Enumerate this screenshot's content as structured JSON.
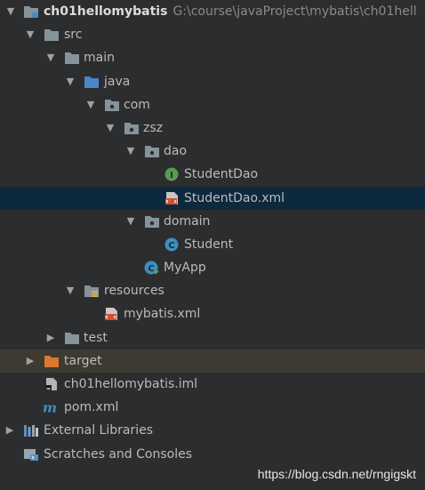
{
  "project": {
    "name": "ch01hellomybatis",
    "path": "G:\\course\\javaProject\\mybatis\\ch01hell"
  },
  "tree": {
    "src": "src",
    "main": "main",
    "java": "java",
    "com": "com",
    "zsz": "zsz",
    "dao": "dao",
    "student_dao": "StudentDao",
    "student_dao_xml": "StudentDao.xml",
    "domain": "domain",
    "student": "Student",
    "myapp": "MyApp",
    "resources": "resources",
    "mybatis_xml": "mybatis.xml",
    "test": "test",
    "target": "target",
    "iml": "ch01hellomybatis.iml",
    "pom": "pom.xml",
    "external_libraries": "External Libraries",
    "scratches": "Scratches and Consoles"
  },
  "icon_letters": {
    "interface": "I",
    "class": "C"
  },
  "watermark": "https://blog.csdn.net/rngigskt",
  "colors": {
    "selection": "#0d293e",
    "excluded_row": "#3d3b31",
    "folder": "#87939a",
    "source_folder": "#4a87c8",
    "target_folder": "#d97830",
    "interface_icon": "#5a9a55",
    "class_icon": "#3f8fbd"
  }
}
